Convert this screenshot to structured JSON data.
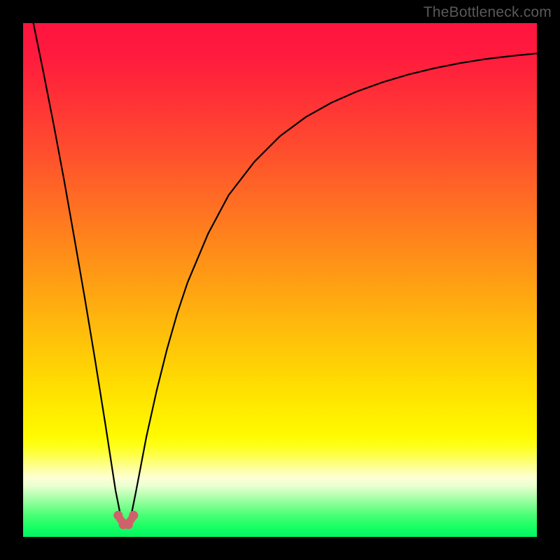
{
  "watermark": "TheBottleneck.com",
  "gradient_stops": [
    {
      "offset": 0.0,
      "color": "#ff153f"
    },
    {
      "offset": 0.06,
      "color": "#ff1a3e"
    },
    {
      "offset": 0.14,
      "color": "#ff2f37"
    },
    {
      "offset": 0.24,
      "color": "#ff4b2e"
    },
    {
      "offset": 0.36,
      "color": "#ff7122"
    },
    {
      "offset": 0.48,
      "color": "#ff9716"
    },
    {
      "offset": 0.6,
      "color": "#ffbd0b"
    },
    {
      "offset": 0.72,
      "color": "#ffe200"
    },
    {
      "offset": 0.8,
      "color": "#fff900"
    },
    {
      "offset": 0.82,
      "color": "#feff13"
    },
    {
      "offset": 0.84,
      "color": "#feff47"
    },
    {
      "offset": 0.855,
      "color": "#feff77"
    },
    {
      "offset": 0.87,
      "color": "#fdffa8"
    },
    {
      "offset": 0.885,
      "color": "#fdffd4"
    },
    {
      "offset": 0.9,
      "color": "#ebffd1"
    },
    {
      "offset": 0.92,
      "color": "#b3ffb0"
    },
    {
      "offset": 0.94,
      "color": "#7bff8f"
    },
    {
      "offset": 0.96,
      "color": "#44ff73"
    },
    {
      "offset": 0.98,
      "color": "#19ff64"
    },
    {
      "offset": 1.0,
      "color": "#00f561"
    }
  ],
  "chart_data": {
    "type": "line",
    "title": "",
    "xlabel": "",
    "ylabel": "",
    "xlim": [
      0,
      100
    ],
    "ylim": [
      0,
      100
    ],
    "x_optimum": 20,
    "series": [
      {
        "name": "bottleneck-curve",
        "x": [
          2,
          4,
          6,
          8,
          10,
          12,
          14,
          16,
          18,
          19,
          20,
          21,
          22,
          24,
          26,
          28,
          30,
          32,
          36,
          40,
          45,
          50,
          55,
          60,
          65,
          70,
          75,
          80,
          85,
          90,
          95,
          100
        ],
        "y": [
          100,
          90.2,
          80.0,
          69.3,
          58.0,
          46.5,
          34.5,
          22.0,
          9.0,
          4.0,
          2.0,
          4.0,
          9.0,
          19.5,
          28.5,
          36.5,
          43.5,
          49.5,
          59.0,
          66.5,
          73.0,
          78.0,
          81.7,
          84.5,
          86.7,
          88.5,
          90.0,
          91.2,
          92.2,
          93.0,
          93.6,
          94.1
        ]
      },
      {
        "name": "optimum-markers",
        "x": [
          18.5,
          19.5,
          20.5,
          21.5
        ],
        "y": [
          4.2,
          2.4,
          2.4,
          4.2
        ]
      }
    ],
    "marker_color": "#d0616a",
    "curve_color": "#000000"
  }
}
